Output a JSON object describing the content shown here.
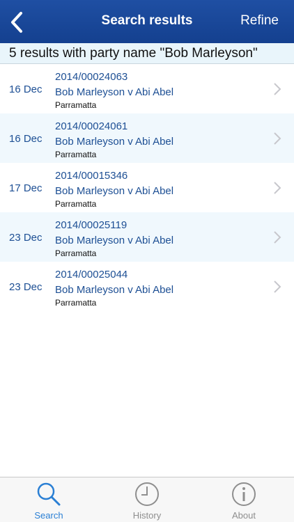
{
  "header": {
    "title": "Search results",
    "refine_label": "Refine"
  },
  "summary": "5 results with party name \"Bob Marleyson\"",
  "results": [
    {
      "date": "16 Dec",
      "case_number": "2014/00024063",
      "parties": "Bob Marleyson v Abi Abel",
      "location": "Parramatta"
    },
    {
      "date": "16 Dec",
      "case_number": "2014/00024061",
      "parties": "Bob Marleyson v Abi Abel",
      "location": "Parramatta"
    },
    {
      "date": "17 Dec",
      "case_number": "2014/00015346",
      "parties": "Bob Marleyson v Abi Abel",
      "location": "Parramatta"
    },
    {
      "date": "23 Dec",
      "case_number": "2014/00025119",
      "parties": "Bob Marleyson v Abi Abel",
      "location": "Parramatta"
    },
    {
      "date": "23 Dec",
      "case_number": "2014/00025044",
      "parties": "Bob Marleyson v Abi Abel",
      "location": "Parramatta"
    }
  ],
  "tabs": [
    {
      "label": "Search",
      "icon": "search-icon",
      "active": true
    },
    {
      "label": "History",
      "icon": "clock-icon",
      "active": false
    },
    {
      "label": "About",
      "icon": "info-icon",
      "active": false
    }
  ],
  "colors": {
    "nav_background": "#1a4a9c",
    "link_text": "#1d4f94",
    "alt_row": "#f0f8fd",
    "active_tab": "#2a7fd4",
    "inactive_tab": "#8e8e8e"
  }
}
